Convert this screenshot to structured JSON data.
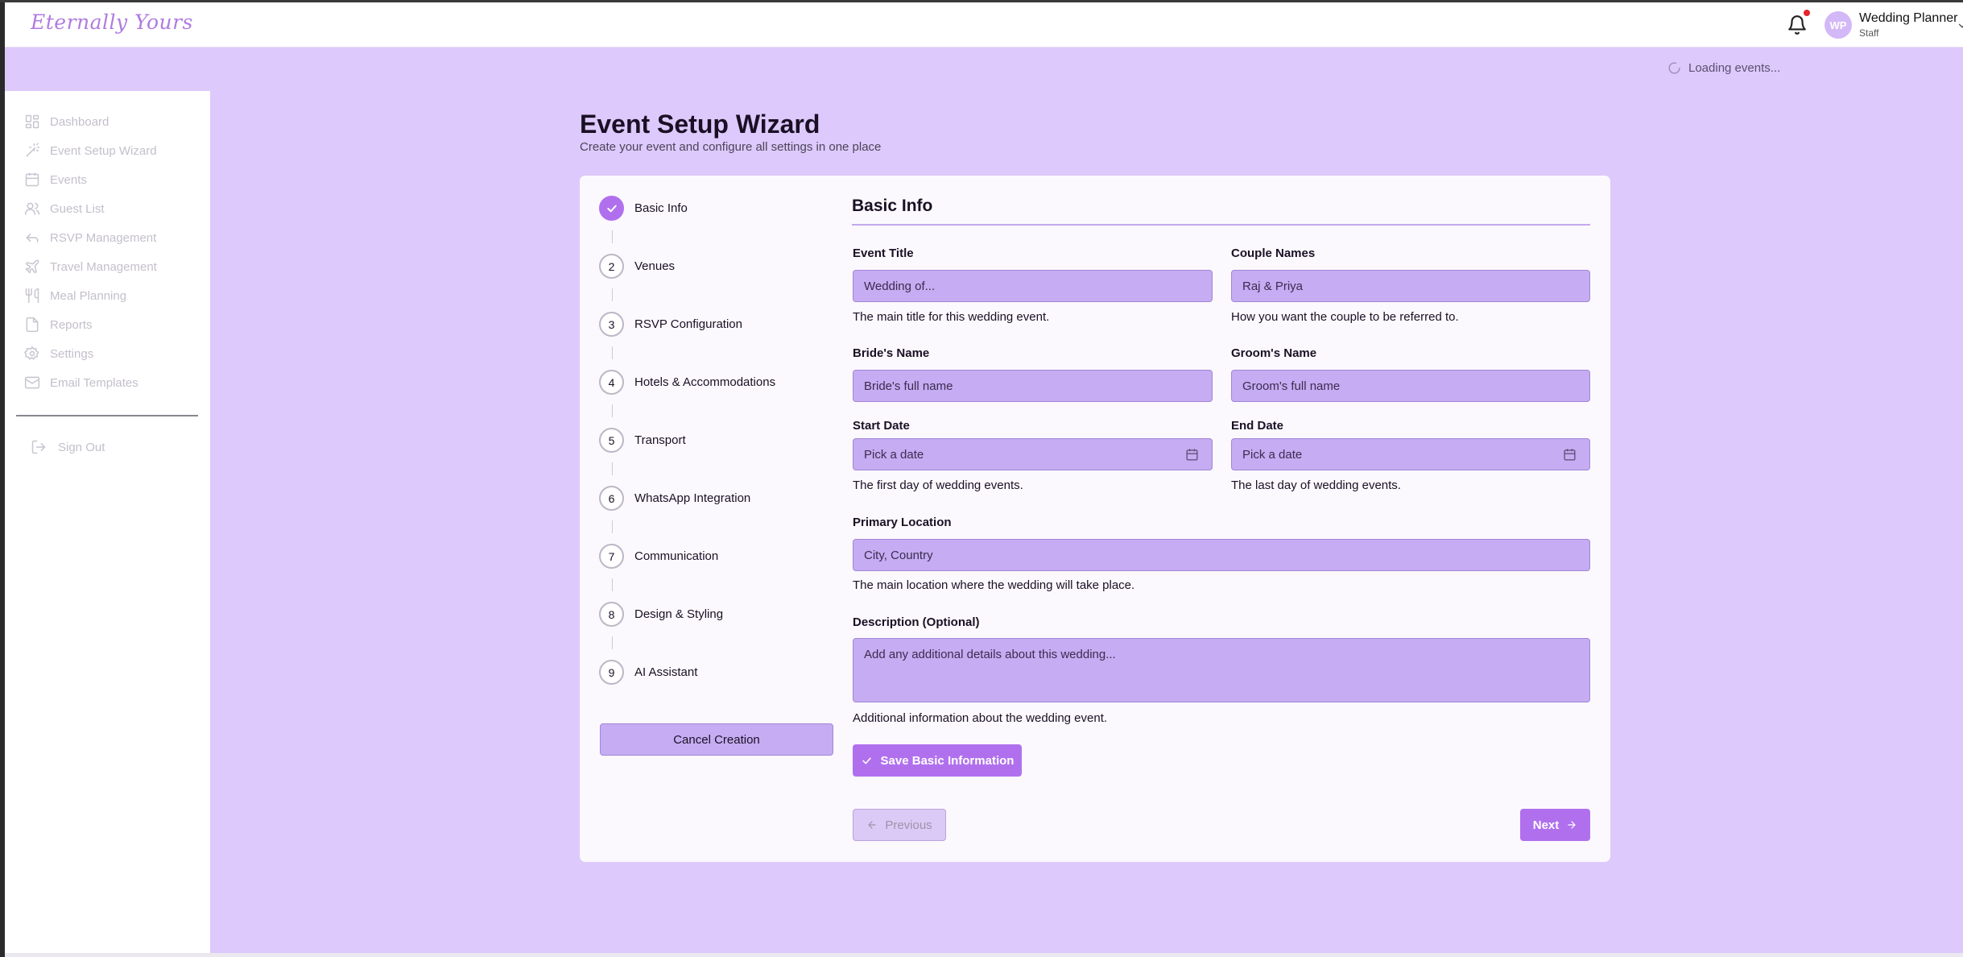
{
  "header": {
    "logo_text": "Eternally Yours",
    "notification_icon": "bell-icon",
    "user": {
      "initials": "WP",
      "name": "Wedding Planner",
      "role": "Staff"
    }
  },
  "status": {
    "loading_text": "Loading events..."
  },
  "sidebar": {
    "items": [
      {
        "label": "Dashboard",
        "icon": "dashboard-icon"
      },
      {
        "label": "Event Setup Wizard",
        "icon": "wand-icon"
      },
      {
        "label": "Events",
        "icon": "calendar-icon"
      },
      {
        "label": "Guest List",
        "icon": "users-icon"
      },
      {
        "label": "RSVP Management",
        "icon": "reply-icon"
      },
      {
        "label": "Travel Management",
        "icon": "plane-icon"
      },
      {
        "label": "Meal Planning",
        "icon": "utensils-icon"
      },
      {
        "label": "Reports",
        "icon": "file-icon"
      },
      {
        "label": "Settings",
        "icon": "gear-icon"
      },
      {
        "label": "Email Templates",
        "icon": "mail-icon"
      }
    ],
    "sign_out": "Sign Out"
  },
  "page": {
    "title": "Event Setup Wizard",
    "subtitle": "Create your event and configure all settings in one place"
  },
  "wizard": {
    "steps": [
      {
        "number": "1",
        "label": "Basic Info",
        "completed": true
      },
      {
        "number": "2",
        "label": "Venues",
        "completed": false
      },
      {
        "number": "3",
        "label": "RSVP Configuration",
        "completed": false
      },
      {
        "number": "4",
        "label": "Hotels & Accommodations",
        "completed": false
      },
      {
        "number": "5",
        "label": "Transport",
        "completed": false
      },
      {
        "number": "6",
        "label": "WhatsApp Integration",
        "completed": false
      },
      {
        "number": "7",
        "label": "Communication",
        "completed": false
      },
      {
        "number": "8",
        "label": "Design & Styling",
        "completed": false
      },
      {
        "number": "9",
        "label": "AI Assistant",
        "completed": false
      }
    ],
    "cancel_label": "Cancel Creation"
  },
  "form": {
    "title": "Basic Info",
    "event_title": {
      "label": "Event Title",
      "value": "Wedding of...",
      "help": "The main title for this wedding event."
    },
    "couple_names": {
      "label": "Couple Names",
      "value": "Raj & Priya",
      "help": "How you want the couple to be referred to."
    },
    "bride_name": {
      "label": "Bride's Name",
      "placeholder": "Bride's full name"
    },
    "groom_name": {
      "label": "Groom's Name",
      "placeholder": "Groom's full name"
    },
    "start_date": {
      "label": "Start Date",
      "placeholder": "Pick a date",
      "help": "The first day of wedding events."
    },
    "end_date": {
      "label": "End Date",
      "placeholder": "Pick a date",
      "help": "The last day of wedding events."
    },
    "primary_location": {
      "label": "Primary Location",
      "placeholder": "City, Country",
      "help": "The main location where the wedding will take place."
    },
    "description": {
      "label": "Description (Optional)",
      "placeholder": "Add any additional details about this wedding...",
      "help": "Additional information about the wedding event."
    },
    "save_label": "Save Basic Information",
    "previous_label": "Previous",
    "next_label": "Next"
  },
  "colors": {
    "background": "#ddc9fb",
    "accent": "#b070ee",
    "field": "#c6acf2"
  }
}
